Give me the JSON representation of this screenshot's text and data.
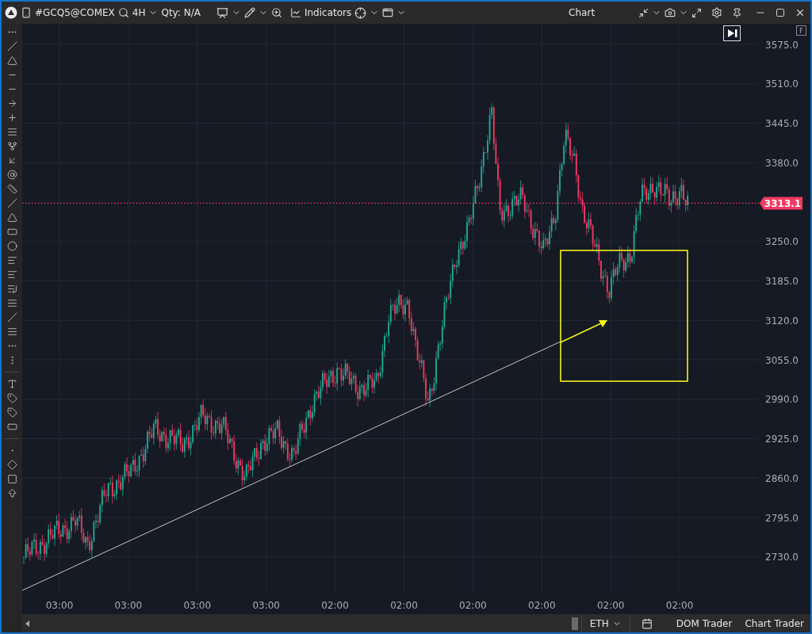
{
  "toolbar": {
    "symbol": "#GCQ5@COMEX",
    "interval": "4H",
    "quantity": "Qty: N/A",
    "indicators": "Indicators",
    "title": "Chart"
  },
  "chart": {
    "price_ticks": [
      "3575.0",
      "3510.0",
      "3445.0",
      "3380.0",
      "3250.0",
      "3185.0",
      "3120.0",
      "3055.0",
      "2990.0",
      "2925.0",
      "2860.0",
      "2795.0",
      "2730.0"
    ],
    "current_price": "3313.1",
    "time_labels": [
      "03:00",
      "03:00",
      "03:00",
      "03:00",
      "02:00",
      "02:00",
      "02:00",
      "02:00",
      "02:00",
      "02:00"
    ],
    "f_button": "F"
  },
  "bottom_bar": {
    "session": "ETH",
    "buttons": [
      "DOM Trader",
      "Chart Trader"
    ]
  }
}
